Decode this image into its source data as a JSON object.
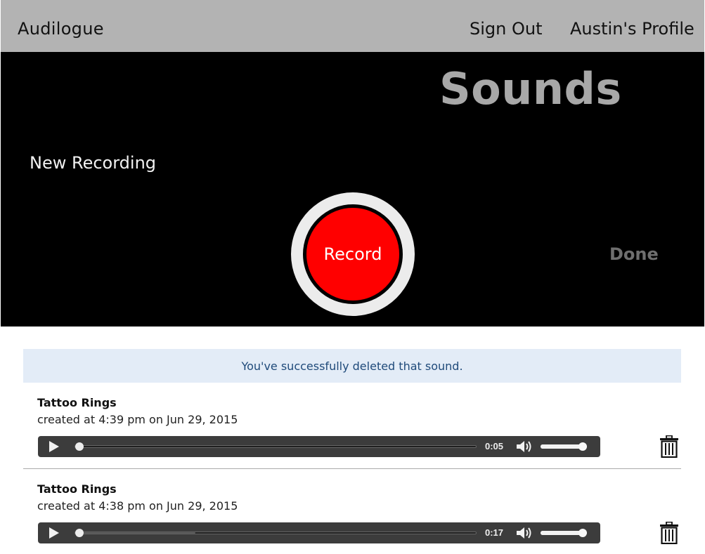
{
  "nav": {
    "brand": "Audilogue",
    "sign_out": "Sign Out",
    "profile": "Austin's Profile"
  },
  "hero": {
    "title": "Sounds",
    "new_recording": "New Recording",
    "record_label": "Record",
    "done_label": "Done"
  },
  "flash": {
    "message": "You've successfully deleted that sound."
  },
  "sounds": [
    {
      "name": "Tattoo Rings",
      "created": "created at 4:39 pm on Jun 29, 2015",
      "time": "0:05",
      "progress": 0.0,
      "buffered": 0.0,
      "volume": 1.0
    },
    {
      "name": "Tattoo Rings",
      "created": "created at 4:38 pm on Jun 29, 2015",
      "time": "0:17",
      "progress": 0.0,
      "buffered": 0.3,
      "volume": 1.0
    }
  ],
  "colors": {
    "navbar": "#b3b3b3",
    "hero_bg": "#000000",
    "record_red": "#ff0000",
    "flash_bg": "#e3ecf7",
    "flash_text": "#1f4a7a"
  },
  "icons": {
    "play": "play-icon",
    "volume": "volume-icon",
    "trash": "trash-icon"
  }
}
